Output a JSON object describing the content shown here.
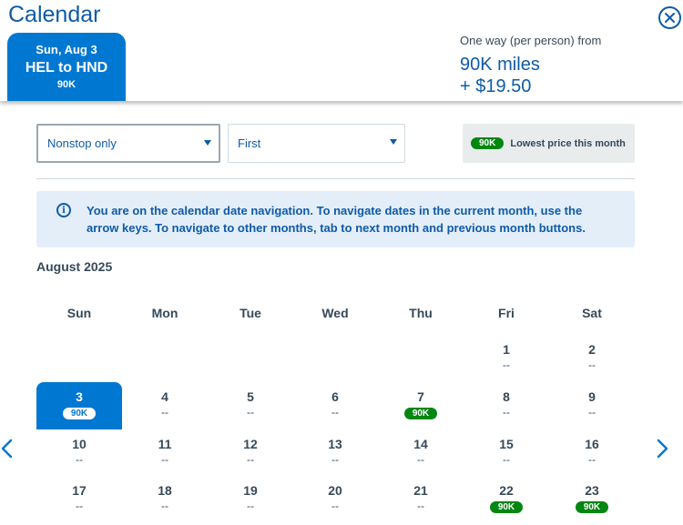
{
  "header": {
    "title": "Calendar",
    "close_icon": "close-icon",
    "selected_tab": {
      "date": "Sun, Aug 3",
      "route": "HEL to HND",
      "price": "90K"
    },
    "fare": {
      "label": "One way (per person) from",
      "miles": "90K miles",
      "cash": "+ $19.50"
    }
  },
  "filters": {
    "stops": {
      "value": "Nonstop only"
    },
    "cabin": {
      "value": "First"
    },
    "legend": {
      "badge": "90K",
      "text": "Lowest price this month"
    }
  },
  "info": {
    "icon": "info-icon",
    "text": "You are on the calendar date navigation. To navigate dates in the current month, use the arrow keys. To navigate to other months, tab to next month and previous month buttons."
  },
  "calendar": {
    "month": "August 2025",
    "weekdays": [
      "Sun",
      "Mon",
      "Tue",
      "Wed",
      "Thu",
      "Fri",
      "Sat"
    ],
    "prev_icon": "chevron-left-icon",
    "next_icon": "chevron-right-icon",
    "accent": "#0078d2",
    "lowest_color": "#008712",
    "days": [
      {
        "day": "1",
        "price": "--"
      },
      {
        "day": "2",
        "price": "--"
      },
      {
        "day": "3",
        "price": "90K",
        "selected": true
      },
      {
        "day": "4",
        "price": "--"
      },
      {
        "day": "5",
        "price": "--"
      },
      {
        "day": "6",
        "price": "--"
      },
      {
        "day": "7",
        "price": "90K",
        "lowest": true
      },
      {
        "day": "8",
        "price": "--"
      },
      {
        "day": "9",
        "price": "--"
      },
      {
        "day": "10",
        "price": "--"
      },
      {
        "day": "11",
        "price": "--"
      },
      {
        "day": "12",
        "price": "--"
      },
      {
        "day": "13",
        "price": "--"
      },
      {
        "day": "14",
        "price": "--"
      },
      {
        "day": "15",
        "price": "--"
      },
      {
        "day": "16",
        "price": "--"
      },
      {
        "day": "17",
        "price": "--"
      },
      {
        "day": "18",
        "price": "--"
      },
      {
        "day": "19",
        "price": "--"
      },
      {
        "day": "20",
        "price": "--"
      },
      {
        "day": "21",
        "price": "--"
      },
      {
        "day": "22",
        "price": "90K",
        "lowest": true
      },
      {
        "day": "23",
        "price": "90K",
        "lowest": true
      }
    ]
  }
}
